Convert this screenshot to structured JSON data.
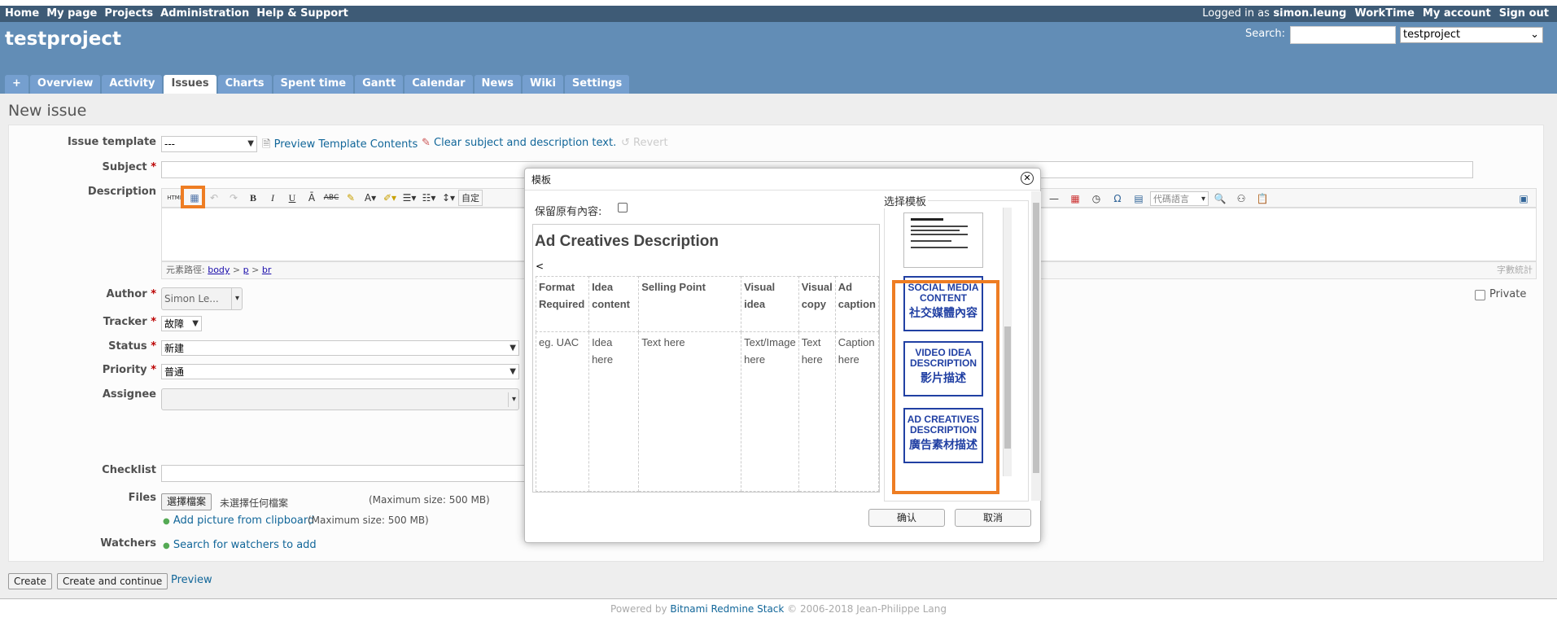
{
  "top_menu": {
    "items": [
      "Home",
      "My page",
      "Projects",
      "Administration",
      "Help & Support"
    ],
    "logged_in_prefix": "Logged in as",
    "user": "simon.leung",
    "right_items": [
      "WorkTime",
      "My account",
      "Sign out"
    ]
  },
  "header": {
    "project_title": "testproject",
    "search_label": "Search:",
    "search_value": "",
    "project_select": "testproject"
  },
  "tabs": [
    "+",
    "Overview",
    "Activity",
    "Issues",
    "Charts",
    "Spent time",
    "Gantt",
    "Calendar",
    "News",
    "Wiki",
    "Settings"
  ],
  "selected_tab": "Issues",
  "page_title": "New issue",
  "form": {
    "issue_template_label": "Issue template",
    "issue_template_value": "---",
    "preview_template_link": "Preview Template Contents",
    "clear_link": "Clear subject and description text.",
    "revert_link": "Revert",
    "subject_label": "Subject",
    "description_label": "Description",
    "path_label": "元素路徑:",
    "path_items": [
      "body",
      "p",
      "br"
    ],
    "word_count": "字數統計",
    "toolbar_font_select": "代碼語言",
    "toolbar_format_prefix": "自定",
    "author_label": "Author",
    "author_value": "Simon Le...",
    "private_label": "Private",
    "tracker_label": "Tracker",
    "tracker_value": "故障",
    "status_label": "Status",
    "status_value": "新建",
    "priority_label": "Priority",
    "priority_value": "普通",
    "assignee_label": "Assignee",
    "checklist_label": "Checklist",
    "files_label": "Files",
    "choose_file_button": "選擇檔案",
    "no_file_text": "未選擇任何檔案",
    "max_size": "(Maximum size: 500 MB)",
    "add_picture_link": "Add picture from clipboard",
    "add_picture_max": "(Maximum size: 500 MB)",
    "watchers_label": "Watchers",
    "search_watchers_link": "Search for watchers to add"
  },
  "actions": {
    "create": "Create",
    "create_continue": "Create and continue",
    "preview": "Preview"
  },
  "footer": {
    "powered_by": "Powered by",
    "stack_link": "Bitnami Redmine Stack",
    "copyright": "© 2006-2018 Jean-Philippe Lang"
  },
  "dialog": {
    "title": "模板",
    "keep_label": "保留原有內容:",
    "select_template_label": "选择模板",
    "preview_heading": "Ad Creatives Description",
    "preview_lt": "<",
    "table_headers": [
      "Format Required",
      "Idea content",
      "Selling Point",
      "Visual idea",
      "Visual copy",
      "Ad caption"
    ],
    "table_row": [
      "eg. UAC",
      "Idea here",
      "Text here",
      "Text/Image here",
      "Text here",
      "Caption here"
    ],
    "templates": [
      {
        "en": "SOCIAL MEDIA CONTENT",
        "zh": "社交媒體內容"
      },
      {
        "en": "VIDEO IDEA DESCRIPTION",
        "zh": "影片描述"
      },
      {
        "en": "AD CREATIVES DESCRIPTION",
        "zh": "廣告素材描述"
      }
    ],
    "ok_button": "确认",
    "cancel_button": "取消"
  },
  "colors": {
    "header_bg": "#628db6",
    "top_menu_bg": "#3e5b76",
    "highlight": "#ee7d23",
    "thumb_blue": "#2140a3"
  }
}
